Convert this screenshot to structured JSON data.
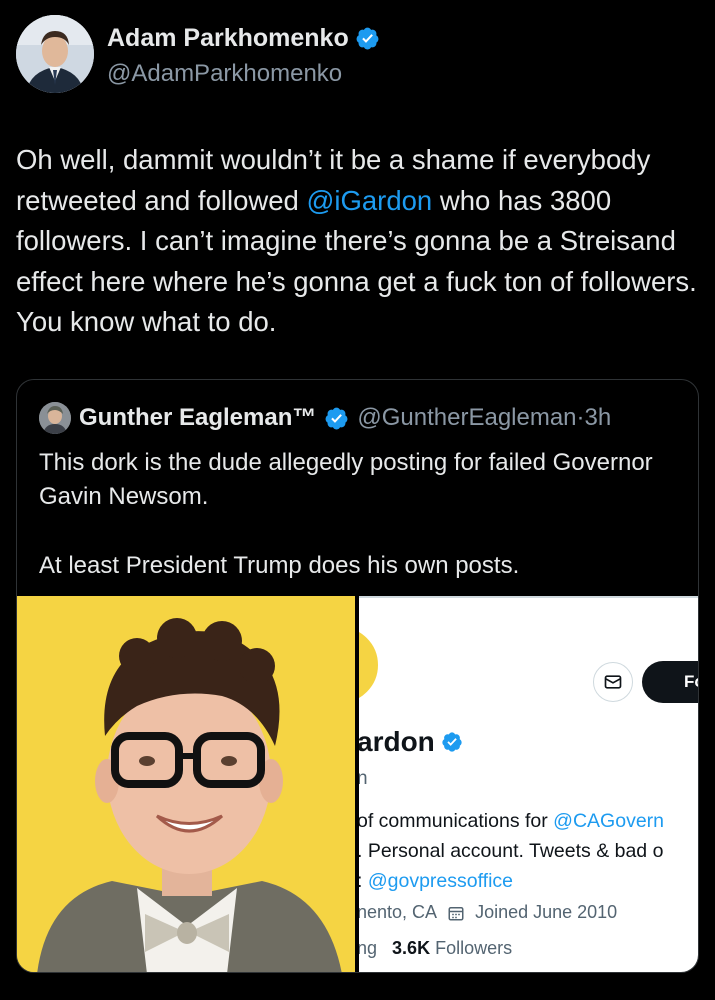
{
  "author": {
    "name": "Adam Parkhomenko",
    "handle": "@AdamParkhomenko"
  },
  "tweet": {
    "text_before": "Oh well, dammit wouldn’t it be a shame if everybody retweeted and followed ",
    "mention": "@iGardon",
    "text_after": " who has 3800 followers. I can’t imagine there’s gonna be a Streisand effect here where he’s gonna get a fuck ton of followers. You know what to do."
  },
  "quote": {
    "name": "Gunther Eagleman™",
    "handle": "@GuntherEagleman",
    "dot": "·",
    "time": "3h",
    "paragraph1": "This dork is the dude allegedly posting for failed Governor Gavin Newsom.",
    "paragraph2": "At least President Trump does his own posts."
  },
  "screenshot_profile": {
    "follow_label": "Fo",
    "name": "ardon",
    "sub": "n",
    "bio_line1_text": "of communications for ",
    "bio_line1_link": "@CAGovern",
    "bio_line2": ". Personal account. Tweets & bad o",
    "bio_line3_prefix": ": ",
    "bio_line3_link": "@govpressoffice",
    "location": "nento, CA",
    "joined": "Joined June 2010",
    "following_fragment": "ng",
    "followers_count": "3.6K",
    "followers_label": "Followers"
  },
  "colors": {
    "accent": "#1d9bf0",
    "background": "#000000",
    "text": "#e7e9ea",
    "muted": "#8b98a5",
    "photo_background": "#f5d443"
  },
  "icons": [
    "verified-badge-icon",
    "message-icon",
    "calendar-icon"
  ]
}
